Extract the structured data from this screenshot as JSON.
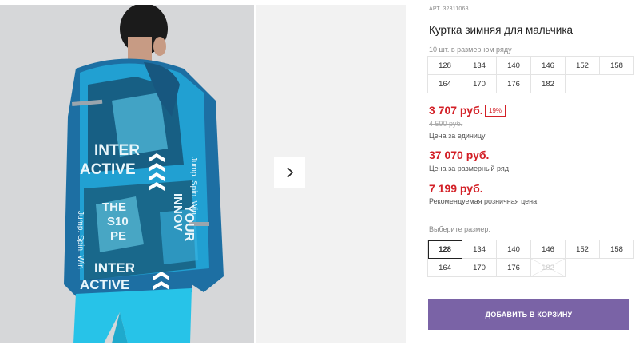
{
  "product": {
    "article_label": "АРТ.",
    "article_number": "32311068",
    "title": "Куртка зимняя для мальчика",
    "row_note": "10 шт. в размерном ряду"
  },
  "size_row": [
    "128",
    "134",
    "140",
    "146",
    "152",
    "158",
    "164",
    "170",
    "176",
    "182"
  ],
  "prices": {
    "unit_price": "3 707 руб.",
    "discount_badge": "19%",
    "old_price": "4 590 руб.",
    "unit_caption": "Цена за единицу",
    "row_price": "37 070 руб.",
    "row_caption": "Цена за размерный ряд",
    "retail_price": "7 199 руб.",
    "retail_caption": "Рекомендуемая розничная цена"
  },
  "size_select": {
    "label": "Выберите размер:",
    "selected": "128",
    "sizes": [
      "128",
      "134",
      "140",
      "146",
      "152",
      "158",
      "164",
      "170",
      "176",
      "182"
    ],
    "unavailable": [
      "182"
    ]
  },
  "cart_button": "ДОБАВИТЬ В КОРЗИНУ",
  "photo_text": {
    "line1": "INTER",
    "line2": "ACTIVE",
    "line3": "THE",
    "line4": "S10",
    "line5": "PE",
    "line6": "Jump. Spin. Win",
    "line7": "YOUR",
    "line8": "INNOV",
    "line9": "INTER",
    "line10": "ACTIVE"
  },
  "colors": {
    "price_red": "#d32027",
    "cart_purple": "#7a63a6",
    "jacket_blue": "#1aa3d6",
    "pants_cyan": "#27c3e8"
  },
  "icons": {
    "next": "chevron-right-icon"
  }
}
